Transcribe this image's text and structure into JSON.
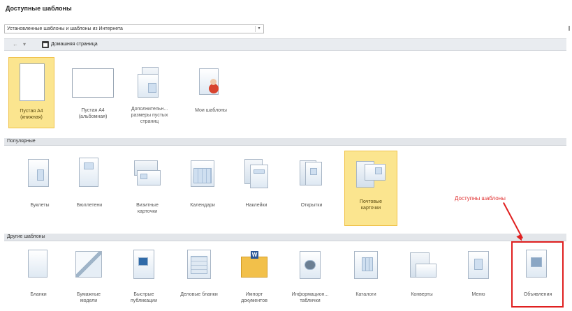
{
  "header": {
    "title": "Доступные шаблоны",
    "source_select": "Установленные шаблоны и шаблоны из Интернета",
    "nav_back": "←",
    "nav_forward": "▾",
    "breadcrumb_home": "Домашняя страница"
  },
  "top_tiles": [
    {
      "label": "Пустая А4 (книжная)",
      "icon": "blank-portrait-page"
    },
    {
      "label": "Пустая А4 (альбомная)",
      "icon": "blank-landscape-page"
    },
    {
      "label": "Дополнительн... размеры пустых страниц",
      "icon": "page-sizes"
    },
    {
      "label": "Мои шаблоны",
      "icon": "my-templates"
    }
  ],
  "sections": {
    "popular": "Популярные",
    "other": "Другие шаблоны"
  },
  "popular_tiles": [
    {
      "label": "Буклеты"
    },
    {
      "label": "Бюллетени"
    },
    {
      "label": "Визитные карточки"
    },
    {
      "label": "Календари"
    },
    {
      "label": "Наклейки"
    },
    {
      "label": "Открытки"
    },
    {
      "label": "Почтовые карточки"
    }
  ],
  "other_tiles": [
    {
      "label": "Бланки"
    },
    {
      "label": "Бумажные модели"
    },
    {
      "label": "Быстрые публикации"
    },
    {
      "label": "Деловые бланки"
    },
    {
      "label": "Импорт документов"
    },
    {
      "label": "Информацион... таблички"
    },
    {
      "label": "Каталоги"
    },
    {
      "label": "Конверты"
    },
    {
      "label": "Меню"
    },
    {
      "label": "Объявления"
    }
  ],
  "annotation": {
    "text": "Доступны шаблоны"
  },
  "colors": {
    "selected_fill": "#fbe58f",
    "annotation_red": "#e02020",
    "section_bar": "#e3e6ea"
  }
}
